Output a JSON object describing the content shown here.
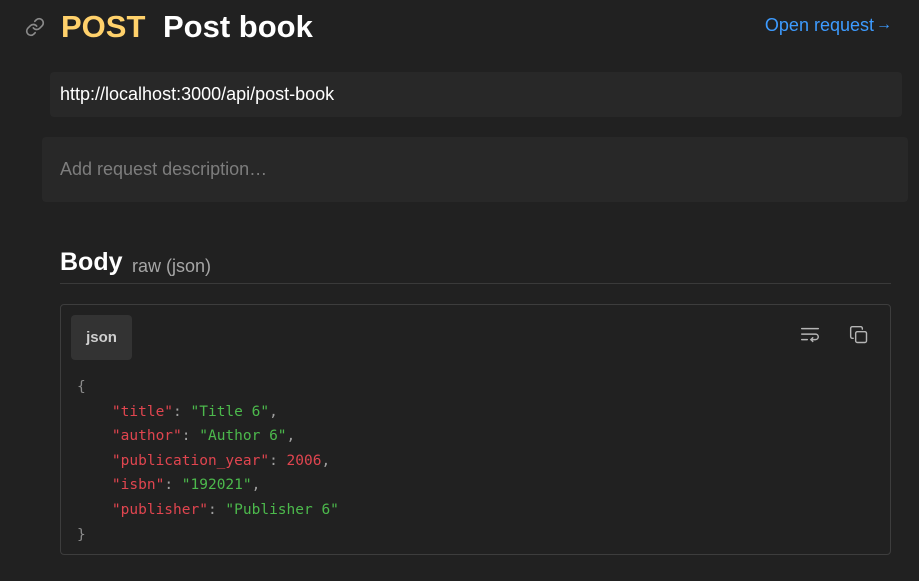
{
  "header": {
    "method": "POST",
    "name": "Post book",
    "open_request_label": "Open request",
    "open_request_arrow": "→"
  },
  "url": "http://localhost:3000/api/post-book",
  "description_placeholder": "Add request description…",
  "body": {
    "title": "Body",
    "mode": "raw (json)",
    "language": "json",
    "open_brace": "{",
    "close_brace": "}",
    "fields": [
      {
        "key": "\"title\"",
        "value": "\"Title 6\"",
        "sep": ","
      },
      {
        "key": "\"author\"",
        "value": "\"Author 6\"",
        "sep": ","
      },
      {
        "key": "\"publication_year\"",
        "value": "2006",
        "sep": ","
      },
      {
        "key": "\"isbn\"",
        "value": "\"192021\"",
        "sep": ","
      },
      {
        "key": "\"publisher\"",
        "value": "\"Publisher 6\"",
        "sep": ""
      }
    ]
  },
  "colors": {
    "method": "#ffd16b",
    "link": "#3d9bff",
    "json_key": "#e0454f",
    "json_string": "#4cb94c",
    "json_number": "#e0454f"
  },
  "icons": {
    "link": "link-icon",
    "wrap": "text-wrap-icon",
    "copy": "copy-icon"
  }
}
